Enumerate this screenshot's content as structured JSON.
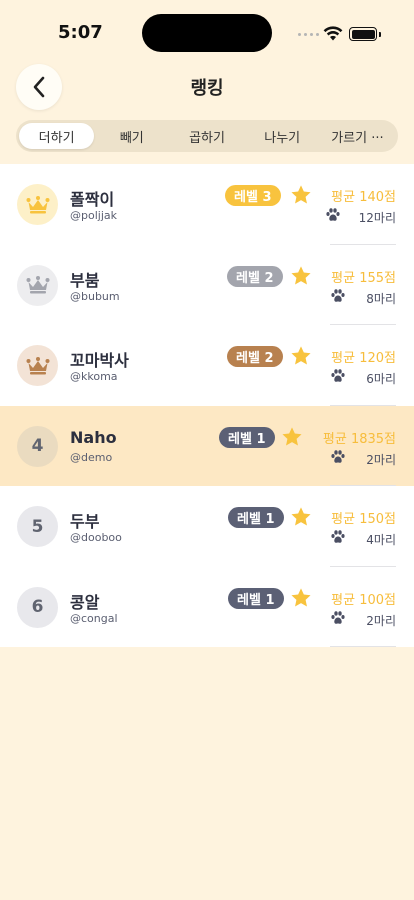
{
  "status_bar": {
    "time": "5:07"
  },
  "header": {
    "title": "랭킹"
  },
  "tabs": [
    {
      "label": "더하기",
      "active": true
    },
    {
      "label": "빼기"
    },
    {
      "label": "곱하기"
    },
    {
      "label": "나누기"
    },
    {
      "label": "가르기 ···"
    }
  ],
  "colors": {
    "background": "#fef3de",
    "gold": "#f8c33e",
    "silver": "#a3a5ad",
    "bronze": "#b8814f",
    "navy_badge": "#5b6075",
    "star": "#f8c33e",
    "highlight_row": "#fde8c4"
  },
  "rankings": [
    {
      "rank": "1",
      "medal": "gold-crown",
      "name": "폴짝이",
      "handle": "@poljjak",
      "level": "레벨 3",
      "average": "평균 140점",
      "count": "12마리"
    },
    {
      "rank": "2",
      "medal": "silver-crown",
      "name": "부붐",
      "handle": "@bubum",
      "level": "레벨 2",
      "average": "평균 155점",
      "count": "8마리"
    },
    {
      "rank": "3",
      "medal": "bronze-crown",
      "name": "꼬마박사",
      "handle": "@kkoma",
      "level": "레벨 2",
      "average": "평균 120점",
      "count": "6마리"
    },
    {
      "rank": "4",
      "name": "Naho",
      "handle": "@demo",
      "level": "레벨 1",
      "average": "평균 1835점",
      "count": "2마리",
      "highlight": true
    },
    {
      "rank": "5",
      "name": "두부",
      "handle": "@dooboo",
      "level": "레벨 1",
      "average": "평균 150점",
      "count": "4마리"
    },
    {
      "rank": "6",
      "name": "콩알",
      "handle": "@congal",
      "level": "레벨 1",
      "average": "평균 100점",
      "count": "2마리"
    }
  ]
}
